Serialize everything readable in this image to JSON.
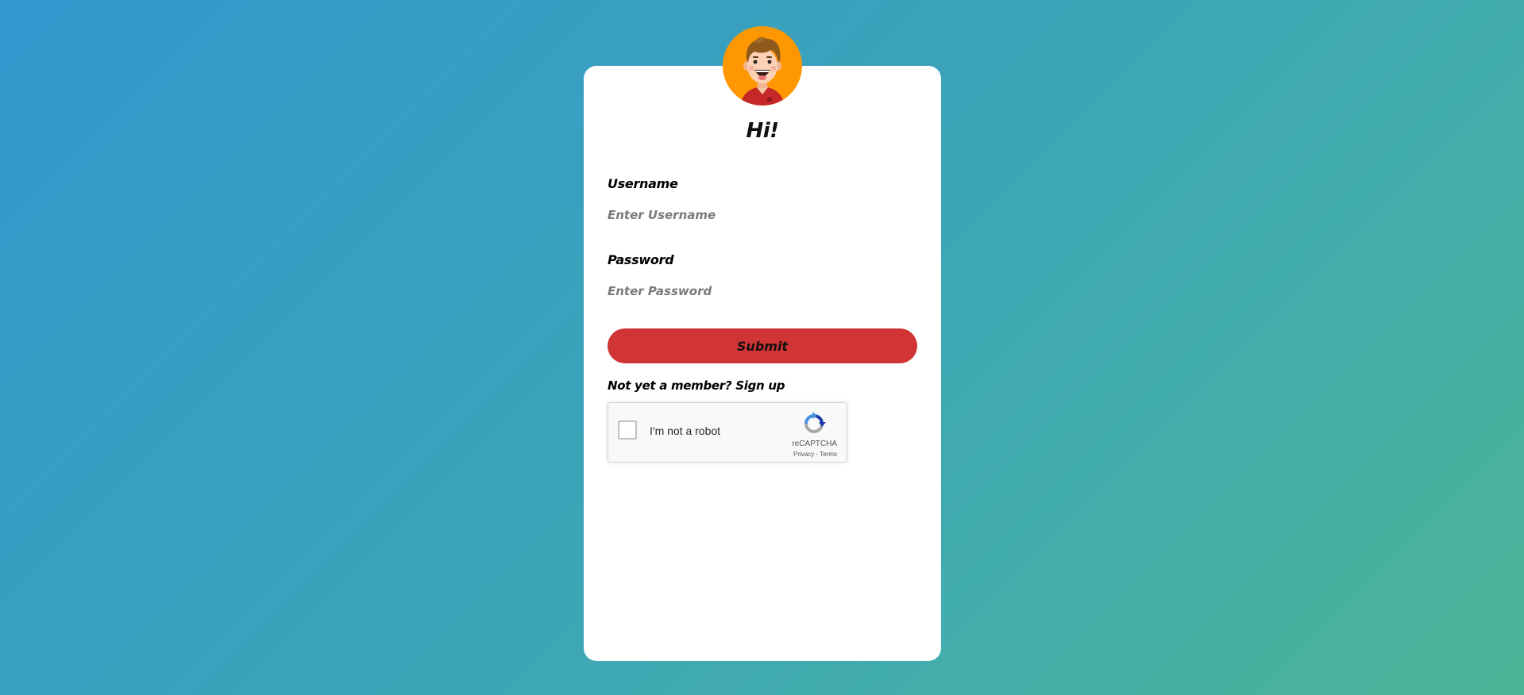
{
  "login": {
    "title": "Hi!",
    "username_label": "Username",
    "username_placeholder": "Enter Username",
    "password_label": "Password",
    "password_placeholder": "Enter Password",
    "submit_label": "Submit",
    "signup_prompt": "Not yet a member?",
    "signup_link": "Sign up"
  },
  "recaptcha": {
    "label": "I'm not a robot",
    "brand": "reCAPTCHA",
    "privacy": "Privacy",
    "separator": " - ",
    "terms": "Terms"
  },
  "colors": {
    "background_start": "#3398cf",
    "background_end": "#4bb496",
    "card": "#ffffff",
    "avatar_bg": "#ff9800",
    "submit_button": "#d13434"
  },
  "icons": {
    "avatar": "cartoon-boy-avatar",
    "recaptcha": "recaptcha-logo-icon"
  }
}
